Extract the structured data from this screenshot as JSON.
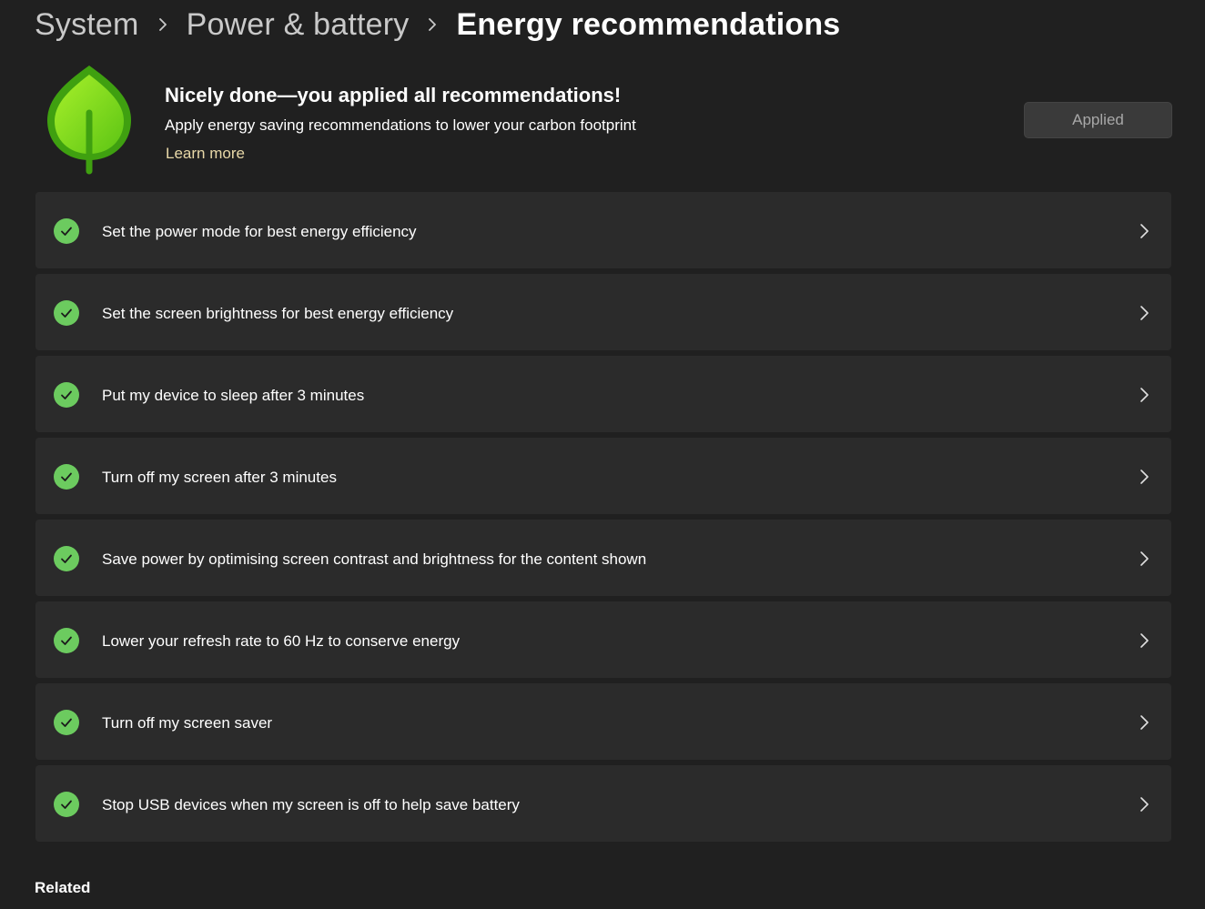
{
  "breadcrumb": {
    "items": [
      "System",
      "Power & battery"
    ],
    "current": "Energy recommendations"
  },
  "hero": {
    "icon": "leaf-icon",
    "title": "Nicely done—you applied all recommendations!",
    "subtitle": "Apply energy saving recommendations to lower your carbon footprint",
    "link": "Learn more",
    "button_label": "Applied"
  },
  "recommendations": [
    {
      "label": "Set the power mode for best energy efficiency",
      "status": "applied"
    },
    {
      "label": "Set the screen brightness for best energy efficiency",
      "status": "applied"
    },
    {
      "label": "Put my device to sleep after 3 minutes",
      "status": "applied"
    },
    {
      "label": "Turn off my screen after 3 minutes",
      "status": "applied"
    },
    {
      "label": "Save power by optimising screen contrast and brightness for the content shown",
      "status": "applied"
    },
    {
      "label": "Lower your refresh rate to 60 Hz to conserve energy",
      "status": "applied"
    },
    {
      "label": "Turn off my screen saver",
      "status": "applied"
    },
    {
      "label": "Stop USB devices when my screen is off to help save battery",
      "status": "applied"
    }
  ],
  "related": {
    "heading": "Related"
  },
  "colors": {
    "background": "#202020",
    "card": "#2b2b2b",
    "check_green": "#6ccb5f",
    "leaf_green": "#7ed321",
    "link": "#e8d8a8"
  }
}
